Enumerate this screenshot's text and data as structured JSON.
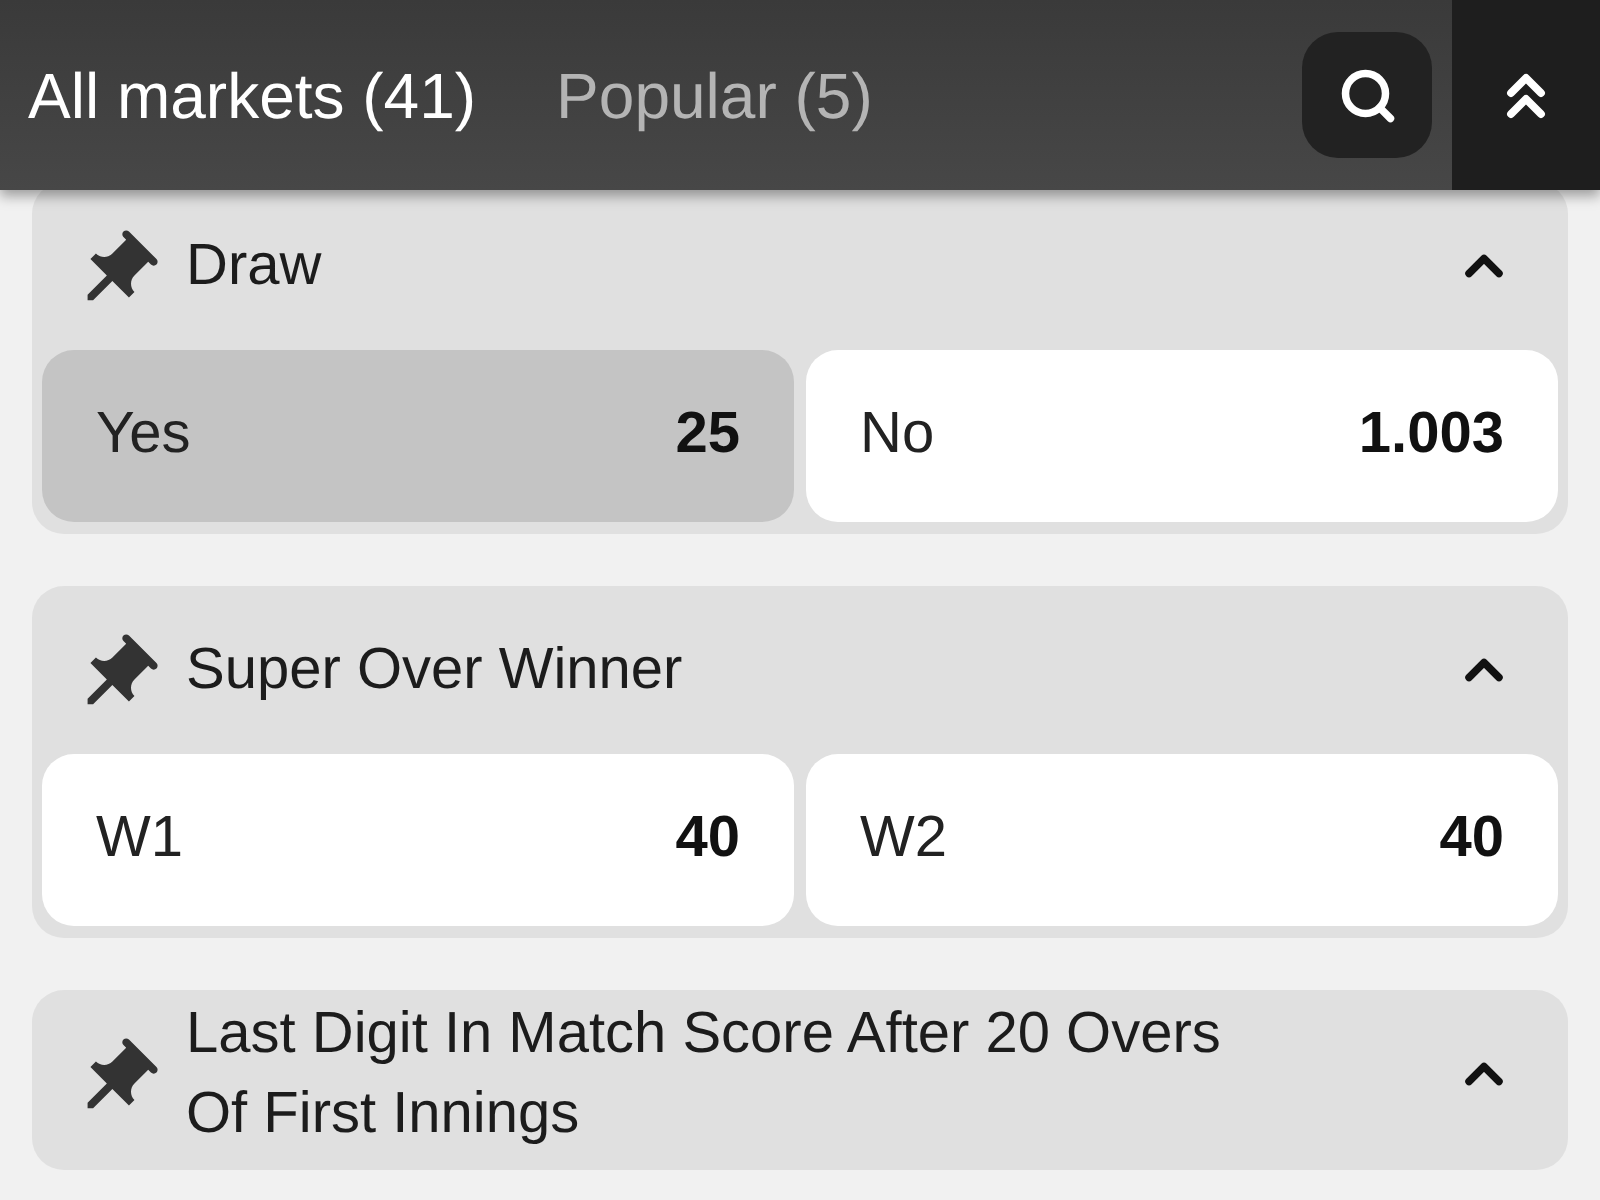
{
  "tabs": [
    {
      "label": "All markets (41)",
      "selected": true
    },
    {
      "label": "Popular (5)",
      "selected": false
    }
  ],
  "markets": [
    {
      "title": "Draw",
      "expanded": true,
      "outcomes": [
        {
          "label": "Yes",
          "odds": "25",
          "selected": true
        },
        {
          "label": "No",
          "odds": "1.003",
          "selected": false
        }
      ]
    },
    {
      "title": "Super Over Winner",
      "expanded": true,
      "outcomes": [
        {
          "label": "W1",
          "odds": "40",
          "selected": false
        },
        {
          "label": "W2",
          "odds": "40",
          "selected": false
        }
      ]
    },
    {
      "title": "Last Digit In Match Score After 20 Overs Of First Innings",
      "expanded": true
    }
  ]
}
